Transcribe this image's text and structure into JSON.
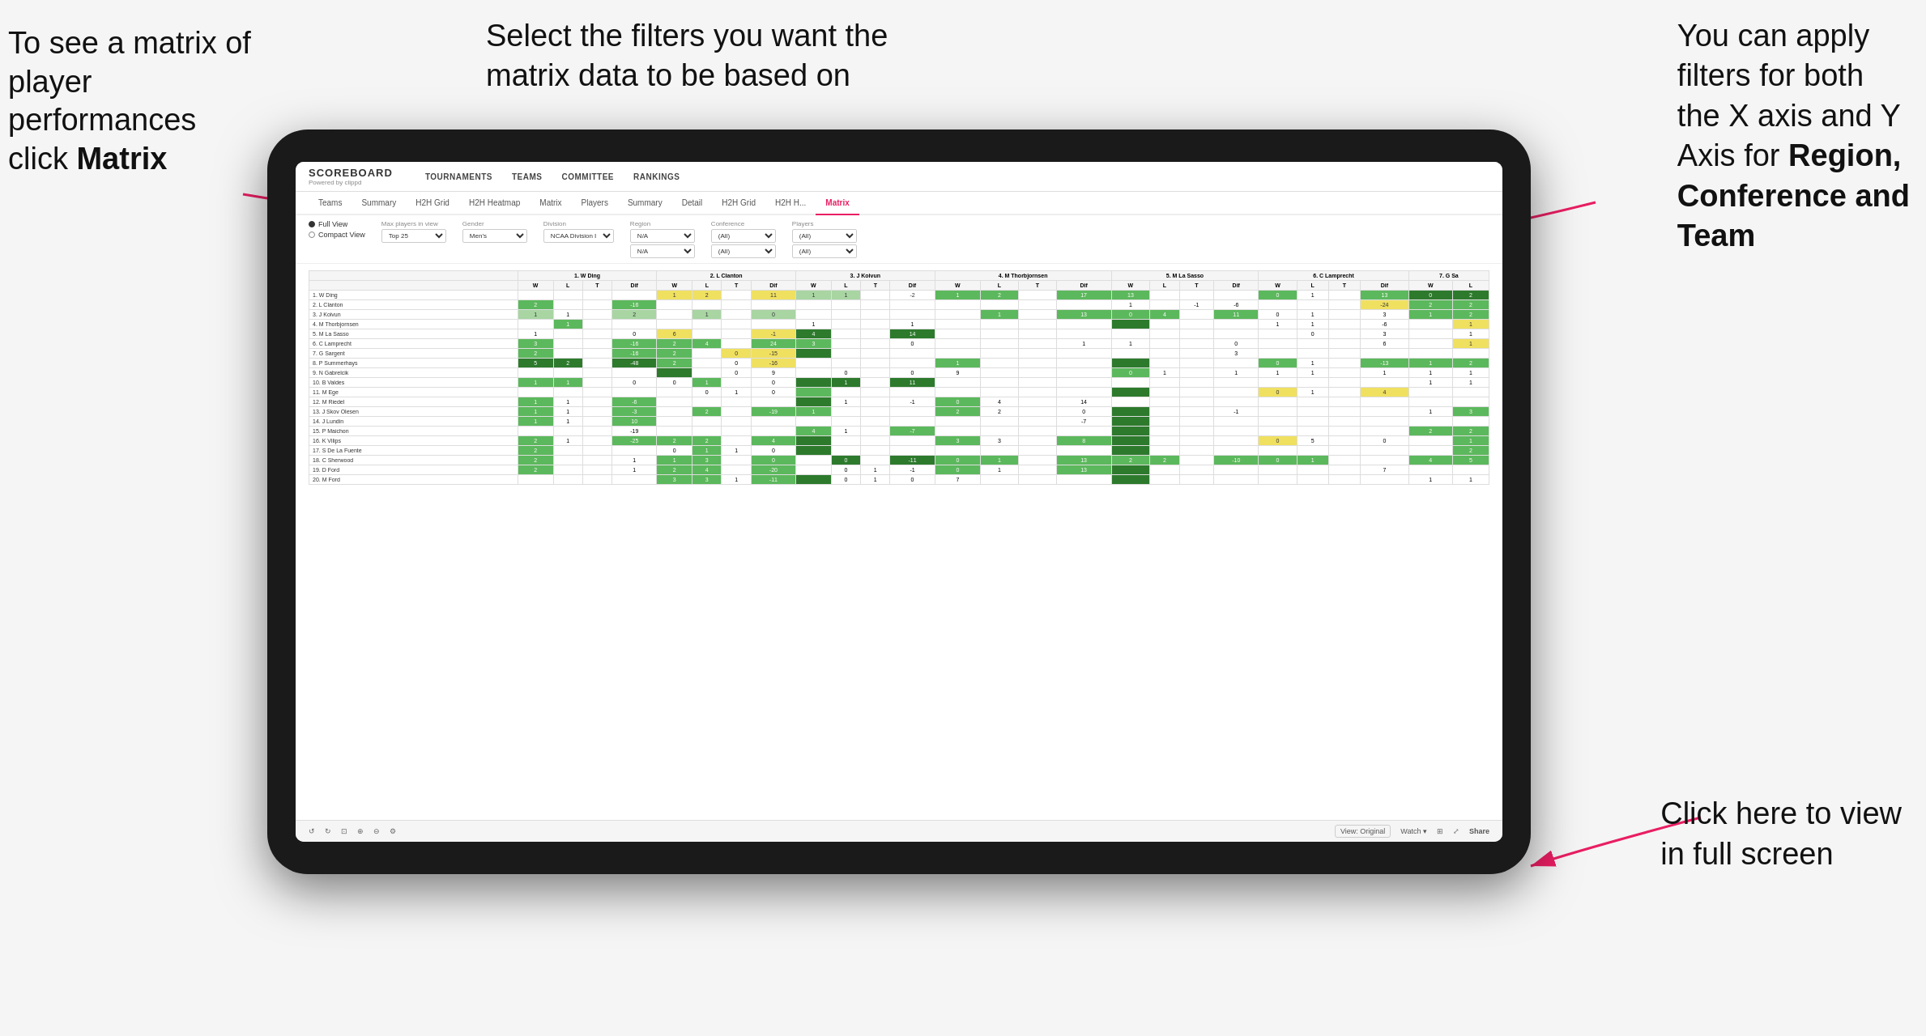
{
  "annotations": {
    "top_left": {
      "line1": "To see a matrix of",
      "line2": "player performances",
      "line3_prefix": "click ",
      "line3_bold": "Matrix"
    },
    "top_center": {
      "text": "Select the filters you want the matrix data to be based on"
    },
    "top_right": {
      "line1": "You  can apply",
      "line2": "filters for both",
      "line3": "the X axis and Y",
      "line4_prefix": "Axis for ",
      "line4_bold": "Region,",
      "line5_bold": "Conference and",
      "line6_bold": "Team"
    },
    "bottom_right": {
      "line1": "Click here to view",
      "line2": "in full screen"
    }
  },
  "nav": {
    "logo": "SCOREBOARD",
    "logo_sub": "Powered by clippd",
    "items": [
      "TOURNAMENTS",
      "TEAMS",
      "COMMITTEE",
      "RANKINGS"
    ]
  },
  "sub_nav": {
    "items": [
      "Teams",
      "Summary",
      "H2H Grid",
      "H2H Heatmap",
      "Matrix",
      "Players",
      "Summary",
      "Detail",
      "H2H Grid",
      "H2H H...",
      "Matrix"
    ],
    "active_index": 10
  },
  "filters": {
    "view_options": [
      "Full View",
      "Compact View"
    ],
    "selected_view": "Full View",
    "max_players_label": "Max players in view",
    "max_players_value": "Top 25",
    "gender_label": "Gender",
    "gender_value": "Men's",
    "division_label": "Division",
    "division_value": "NCAA Division I",
    "region_label": "Region",
    "region_value1": "N/A",
    "region_value2": "N/A",
    "conference_label": "Conference",
    "conference_value1": "(All)",
    "conference_value2": "(All)",
    "players_label": "Players",
    "players_value1": "(All)",
    "players_value2": "(All)"
  },
  "matrix": {
    "column_headers": [
      "1. W Ding",
      "2. L Clanton",
      "3. J Koivun",
      "4. M Thorbjornsen",
      "5. M La Sasso",
      "6. C Lamprecht",
      "7. G Sa"
    ],
    "sub_headers": [
      "W",
      "L",
      "T",
      "Dif"
    ],
    "rows": [
      {
        "name": "1. W Ding",
        "num": "1"
      },
      {
        "name": "2. L Clanton",
        "num": "2"
      },
      {
        "name": "3. J Koivun",
        "num": "3"
      },
      {
        "name": "4. M Thorbjornsen",
        "num": "4"
      },
      {
        "name": "5. M La Sasso",
        "num": "5"
      },
      {
        "name": "6. C Lamprecht",
        "num": "6"
      },
      {
        "name": "7. G Sargent",
        "num": "7"
      },
      {
        "name": "8. P Summerhays",
        "num": "8"
      },
      {
        "name": "9. N Gabrelcik",
        "num": "9"
      },
      {
        "name": "10. B Valdes",
        "num": "10"
      },
      {
        "name": "11. M Ege",
        "num": "11"
      },
      {
        "name": "12. M Riedel",
        "num": "12"
      },
      {
        "name": "13. J Skov Olesen",
        "num": "13"
      },
      {
        "name": "14. J Lundin",
        "num": "14"
      },
      {
        "name": "15. P Maichon",
        "num": "15"
      },
      {
        "name": "16. K Vilips",
        "num": "16"
      },
      {
        "name": "17. S De La Fuente",
        "num": "17"
      },
      {
        "name": "18. C Sherwood",
        "num": "18"
      },
      {
        "name": "19. D Ford",
        "num": "19"
      },
      {
        "name": "20. M Ford",
        "num": "20"
      }
    ]
  },
  "toolbar": {
    "view_original": "View: Original",
    "watch": "Watch ▾",
    "share": "Share"
  }
}
